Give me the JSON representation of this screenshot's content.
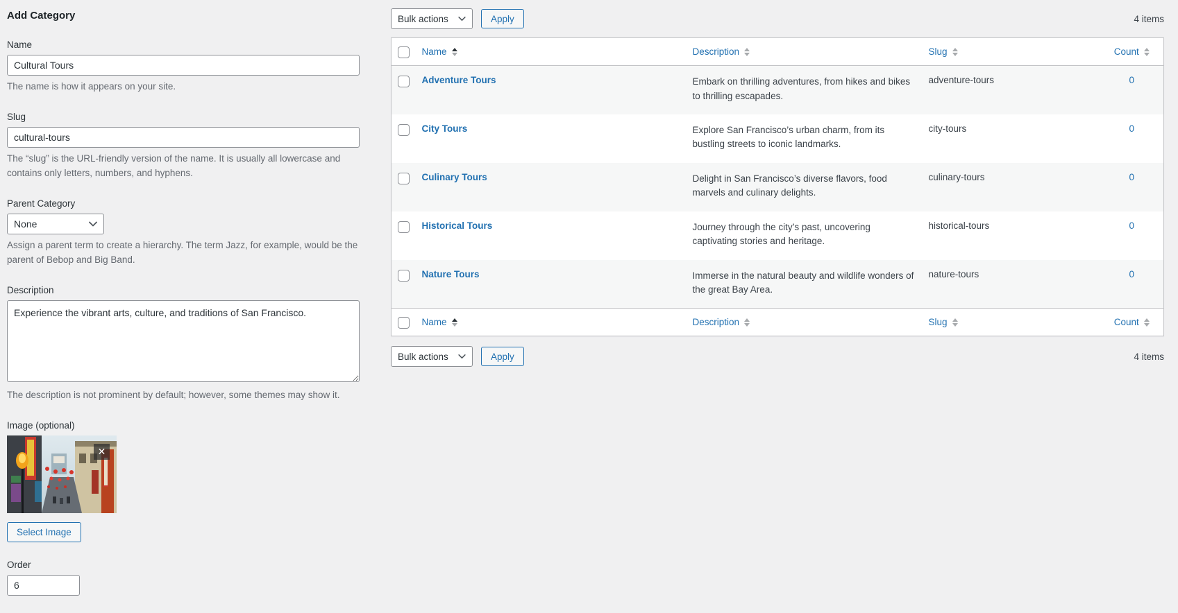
{
  "colors": {
    "page_background": "#f0f0f1",
    "accent_link_blue": "#2271b1",
    "table_border": "#c3c4c7",
    "row_alt_background": "#f6f7f7",
    "input_border": "#8c8f94",
    "muted_text": "#646970",
    "heading_text": "#1d2327"
  },
  "icons": {
    "remove_image": "close-icon",
    "select_dropdown": "chevron-down-icon",
    "column_sort": "sort-arrows-icon"
  },
  "form": {
    "title": "Add Category",
    "name": {
      "label": "Name",
      "value": "Cultural Tours",
      "help": "The name is how it appears on your site."
    },
    "slug": {
      "label": "Slug",
      "value": "cultural-tours",
      "help": "The “slug” is the URL-friendly version of the name. It is usually all lowercase and contains only letters, numbers, and hyphens."
    },
    "parent": {
      "label": "Parent Category",
      "selected": "None",
      "help": "Assign a parent term to create a hierarchy. The term Jazz, for example, would be the parent of Bebop and Big Band."
    },
    "description": {
      "label": "Description",
      "value": "Experience the vibrant arts, culture, and traditions of San Francisco.",
      "help": "The description is not prominent by default; however, some themes may show it."
    },
    "image": {
      "label": "Image (optional)",
      "remove_glyph": "✕",
      "button": "Select Image"
    },
    "order": {
      "label": "Order",
      "value": "6"
    }
  },
  "list": {
    "toolbar_top": {
      "bulk_actions_label": "Bulk actions",
      "apply_label": "Apply",
      "items_count": "4 items"
    },
    "toolbar_bottom": {
      "bulk_actions_label": "Bulk actions",
      "apply_label": "Apply",
      "items_count": "4 items"
    },
    "table": {
      "headers": {
        "name": "Name",
        "description": "Description",
        "slug": "Slug",
        "count": "Count"
      },
      "rows": [
        {
          "name": "Adventure Tours",
          "description": "Embark on thrilling adventures, from hikes and bikes to thrilling escapades.",
          "slug": "adventure-tours",
          "count": "0"
        },
        {
          "name": "City Tours",
          "description": "Explore San Francisco’s urban charm, from its bustling streets to iconic landmarks.",
          "slug": "city-tours",
          "count": "0"
        },
        {
          "name": "Culinary Tours",
          "description": "Delight in San Francisco’s diverse flavors, food marvels and culinary delights.",
          "slug": "culinary-tours",
          "count": "0"
        },
        {
          "name": "Historical Tours",
          "description": "Journey through the city’s past, uncovering captivating stories and heritage.",
          "slug": "historical-tours",
          "count": "0"
        },
        {
          "name": "Nature Tours",
          "description": "Immerse in the natural beauty and wildlife wonders of the great Bay Area.",
          "slug": "nature-tours",
          "count": "0"
        }
      ]
    }
  }
}
